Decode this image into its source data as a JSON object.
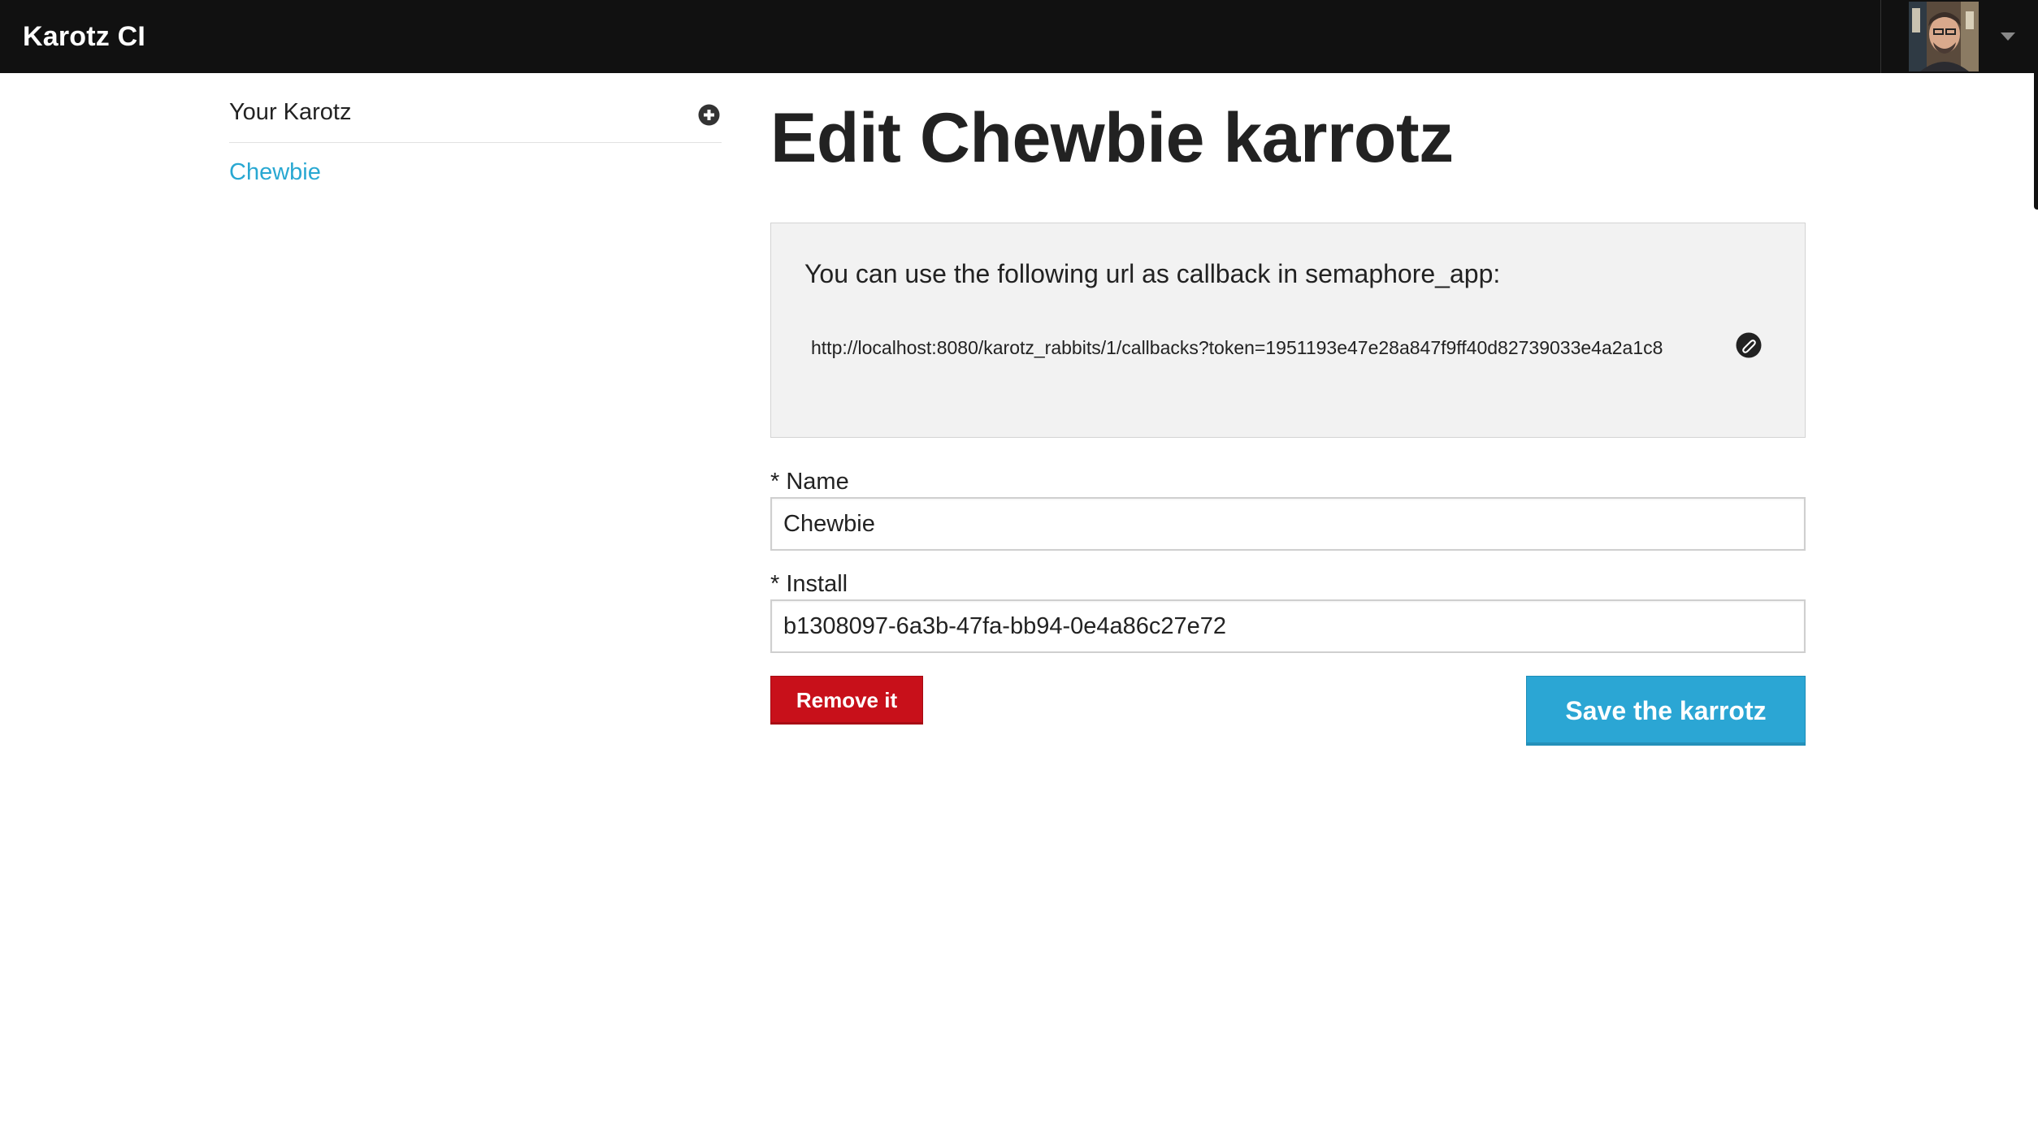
{
  "app": {
    "title": "Karotz CI"
  },
  "header": {
    "user_menu": {
      "avatar": "user-avatar",
      "caret": "chevron-down-icon"
    }
  },
  "sidebar": {
    "title": "Your Karotz",
    "add_icon": "plus-circle-icon",
    "items": [
      {
        "label": "Chewbie",
        "active": true
      }
    ]
  },
  "main": {
    "title": "Edit Chewbie karrotz",
    "callout": {
      "text": "You can use the following url as callback in semaphore_app:",
      "url": "http://localhost:8080/karotz_rabbits/1/callbacks?token=1951193e47e28a847f9ff40d82739033e4a2a1c8",
      "copy_icon": "paperclip-icon"
    },
    "form": {
      "name": {
        "label": "* Name",
        "value": "Chewbie"
      },
      "install": {
        "label": "* Install",
        "value": "b1308097-6a3b-47fa-bb94-0e4a86c27e72"
      }
    },
    "buttons": {
      "remove": "Remove it",
      "save": "Save the karrotz"
    }
  },
  "colors": {
    "topbar": "#111111",
    "link": "#29a8d2",
    "danger": "#c8101a",
    "primary": "#2ba6d4",
    "callout_bg": "#f2f2f2"
  }
}
